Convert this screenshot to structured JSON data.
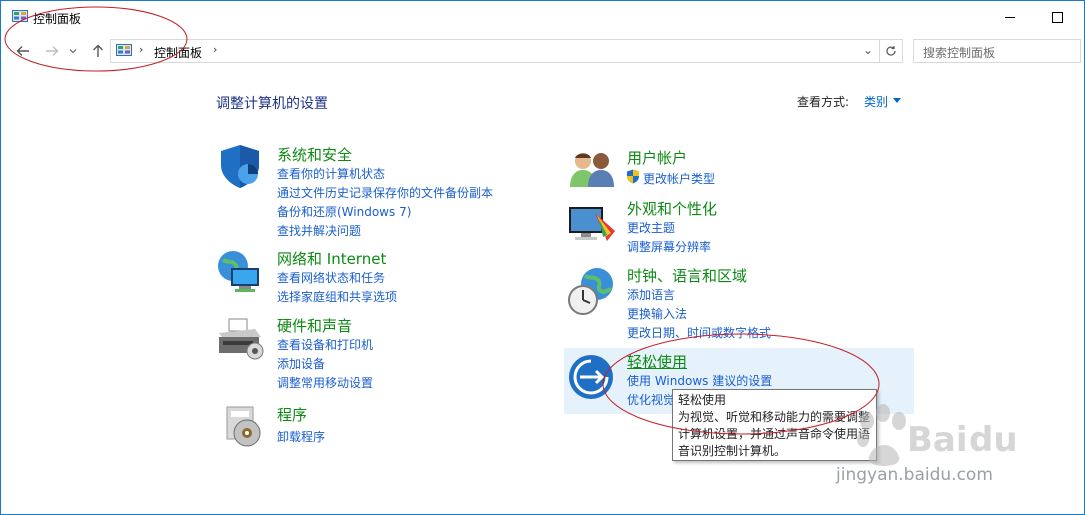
{
  "window": {
    "title": "控制面板"
  },
  "nav": {
    "breadcrumb": "控制面板",
    "search_placeholder": "搜索控制面板"
  },
  "main": {
    "heading": "调整计算机的设置",
    "view_by_label": "查看方式:",
    "view_by_value": "类别"
  },
  "categories": [
    {
      "title": "系统和安全",
      "icon": "shield-icon",
      "links": [
        "查看你的计算机状态",
        "通过文件历史记录保存你的文件备份副本",
        "备份和还原(Windows 7)",
        "查找并解决问题"
      ]
    },
    {
      "title": "网络和 Internet",
      "icon": "network-globe-icon",
      "links": [
        "查看网络状态和任务",
        "选择家庭组和共享选项"
      ]
    },
    {
      "title": "硬件和声音",
      "icon": "printer-icon",
      "links": [
        "查看设备和打印机",
        "添加设备",
        "调整常用移动设置"
      ]
    },
    {
      "title": "程序",
      "icon": "programs-icon",
      "links": [
        "卸载程序"
      ]
    },
    {
      "title": "用户帐户",
      "icon": "users-icon",
      "links": [
        "更改帐户类型"
      ]
    },
    {
      "title": "外观和个性化",
      "icon": "appearance-icon",
      "links": [
        "更改主题",
        "调整屏幕分辨率"
      ]
    },
    {
      "title": "时钟、语言和区域",
      "icon": "clock-globe-icon",
      "links": [
        "添加语言",
        "更换输入法",
        "更改日期、时间或数字格式"
      ]
    },
    {
      "title": "轻松使用",
      "icon": "ease-of-access-icon",
      "links": [
        "使用 Windows 建议的设置",
        "优化视觉"
      ]
    }
  ],
  "tooltip": {
    "title": "轻松使用",
    "body": "为视觉、听觉和移动能力的需要调整计算机设置，并通过声音命令使用语音识别控制计算机。"
  },
  "watermark": {
    "text": "jingyan.baidu.com"
  },
  "colors": {
    "category_title": "#0d8a14",
    "link": "#1a5fcf",
    "heading": "#1e3287",
    "hover_bg": "#e5f1fb",
    "annotation": "#c0202a"
  }
}
